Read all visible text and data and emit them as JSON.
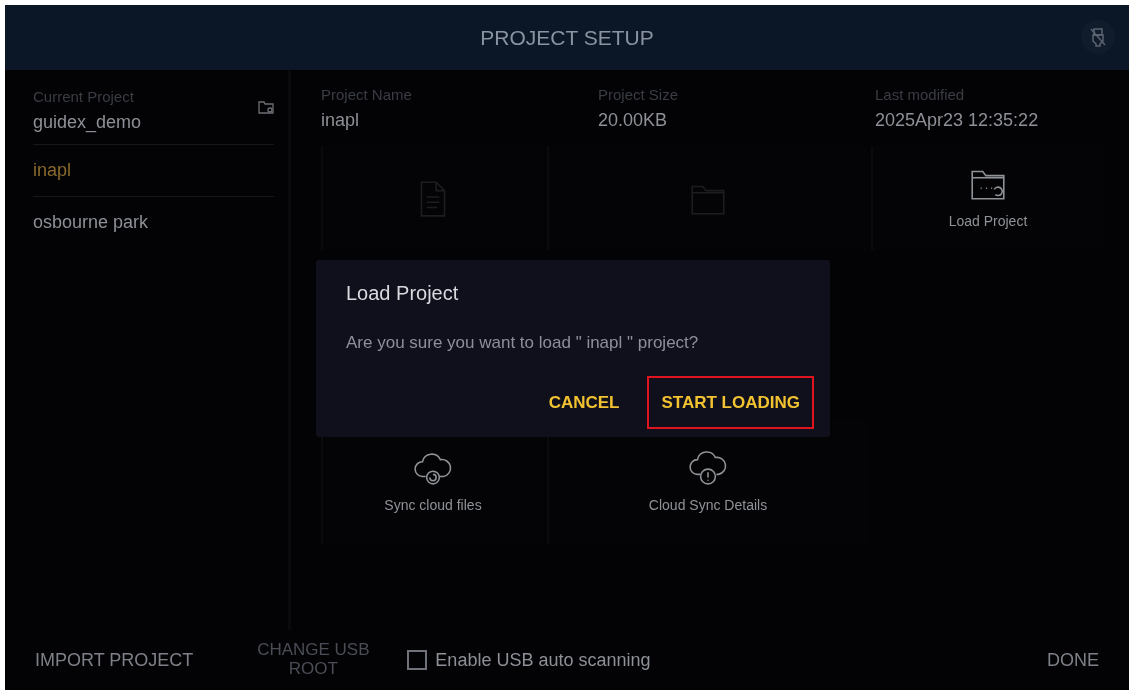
{
  "header": {
    "title": "PROJECT SETUP"
  },
  "sidebar": {
    "current_label": "Current Project",
    "current_value": "guidex_demo",
    "projects": [
      {
        "name": "inapl",
        "selected": true
      },
      {
        "name": "osbourne park",
        "selected": false
      }
    ]
  },
  "info": [
    {
      "label": "Project Name",
      "value": "inapl"
    },
    {
      "label": "Project Size",
      "value": "20.00KB"
    },
    {
      "label": "Last modified",
      "value": "2025Apr23 12:35:22"
    }
  ],
  "tiles": [
    {
      "kind": "document",
      "dimmed": true
    },
    {
      "kind": "folder",
      "dimmed": true
    },
    {
      "kind": "load",
      "label": "Load Project",
      "dimmed": false
    },
    {
      "kind": "sync",
      "label": "Sync cloud files",
      "dimmed": false
    },
    {
      "kind": "cloud-alert",
      "label": "Cloud Sync Details",
      "dimmed": false
    }
  ],
  "dialog": {
    "title": "Load Project",
    "message": "Are you sure you want to load \" inapl \" project?",
    "buttons": [
      {
        "label": "CANCEL",
        "highlighted": false
      },
      {
        "label": "START LOADING",
        "highlighted": true
      }
    ]
  },
  "footer": {
    "import": "IMPORT PROJECT",
    "change_usb": "CHANGE USB ROOT",
    "auto_scan": {
      "label": "Enable USB auto scanning",
      "checked": false
    },
    "done": "DONE"
  }
}
